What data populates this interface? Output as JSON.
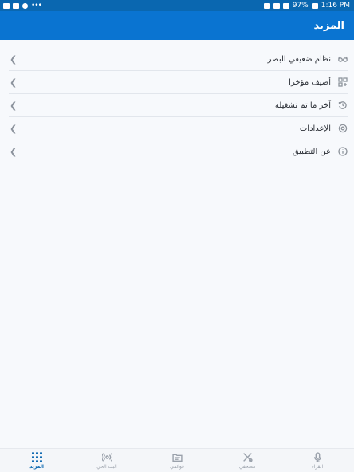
{
  "status_bar": {
    "time": "1:16 PM",
    "battery": "97%",
    "dots": "•••"
  },
  "header": {
    "title": "المزيد"
  },
  "menu": [
    {
      "label": "نظام ضعيفي البصر",
      "icon": "glasses-icon"
    },
    {
      "label": "أضيف مؤخرا",
      "icon": "grid-icon"
    },
    {
      "label": "آخر ما تم تشغيله",
      "icon": "history-icon"
    },
    {
      "label": "الإعدادات",
      "icon": "gear-icon"
    },
    {
      "label": "عن التطبيق",
      "icon": "info-icon"
    }
  ],
  "bottom_nav": [
    {
      "label": "المزيد",
      "icon": "dots-grid-icon",
      "active": true
    },
    {
      "label": "البث الحي",
      "icon": "broadcast-icon"
    },
    {
      "label": "قوائمي",
      "icon": "folder-icon"
    },
    {
      "label": "مصحفي",
      "icon": "mushaf-icon"
    },
    {
      "label": "القراء",
      "icon": "microphone-icon"
    }
  ],
  "colors": {
    "primary": "#0a74d1",
    "status_bar": "#0a67b0",
    "background": "#f7f9fc"
  }
}
